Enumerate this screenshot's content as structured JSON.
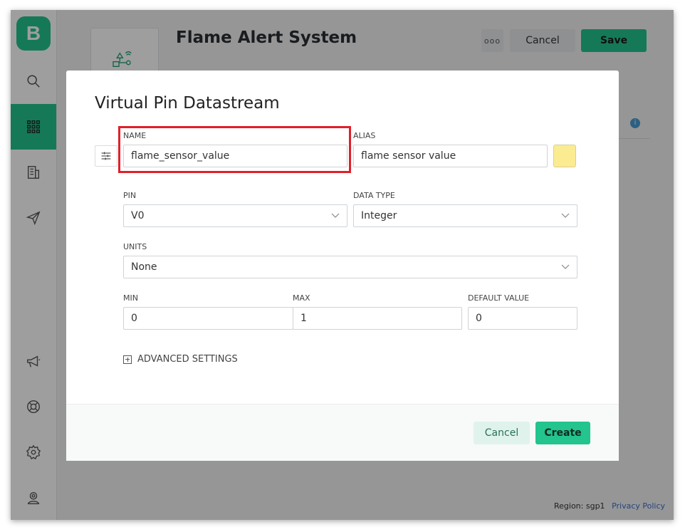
{
  "app": {
    "logo_letter": "B"
  },
  "sidebar": {
    "items": [
      {
        "icon": "search-icon"
      },
      {
        "icon": "grid-icon",
        "active": true
      },
      {
        "icon": "building-icon"
      },
      {
        "icon": "send-icon"
      },
      {
        "icon": "megaphone-icon"
      },
      {
        "icon": "lifebuoy-icon"
      },
      {
        "icon": "gear-icon"
      },
      {
        "icon": "user-icon"
      }
    ]
  },
  "header": {
    "title": "Flame Alert System",
    "more_label": "ooo",
    "cancel_label": "Cancel",
    "save_label": "Save"
  },
  "footer": {
    "region": "Region: sgp1",
    "privacy": "Privacy Policy"
  },
  "modal": {
    "title": "Virtual Pin Datastream",
    "name": {
      "label": "NAME",
      "value": "flame_sensor_value"
    },
    "alias": {
      "label": "ALIAS",
      "value": "flame sensor value"
    },
    "swatch_color": "#fbeb91",
    "pin": {
      "label": "PIN",
      "value": "V0"
    },
    "data_type": {
      "label": "DATA TYPE",
      "value": "Integer"
    },
    "units": {
      "label": "UNITS",
      "value": "None"
    },
    "min": {
      "label": "MIN",
      "value": "0"
    },
    "max": {
      "label": "MAX",
      "value": "1"
    },
    "default_value": {
      "label": "DEFAULT VALUE",
      "value": "0"
    },
    "advanced_label": "ADVANCED SETTINGS",
    "cancel_label": "Cancel",
    "create_label": "Create",
    "highlight_color": "#e0202a"
  }
}
